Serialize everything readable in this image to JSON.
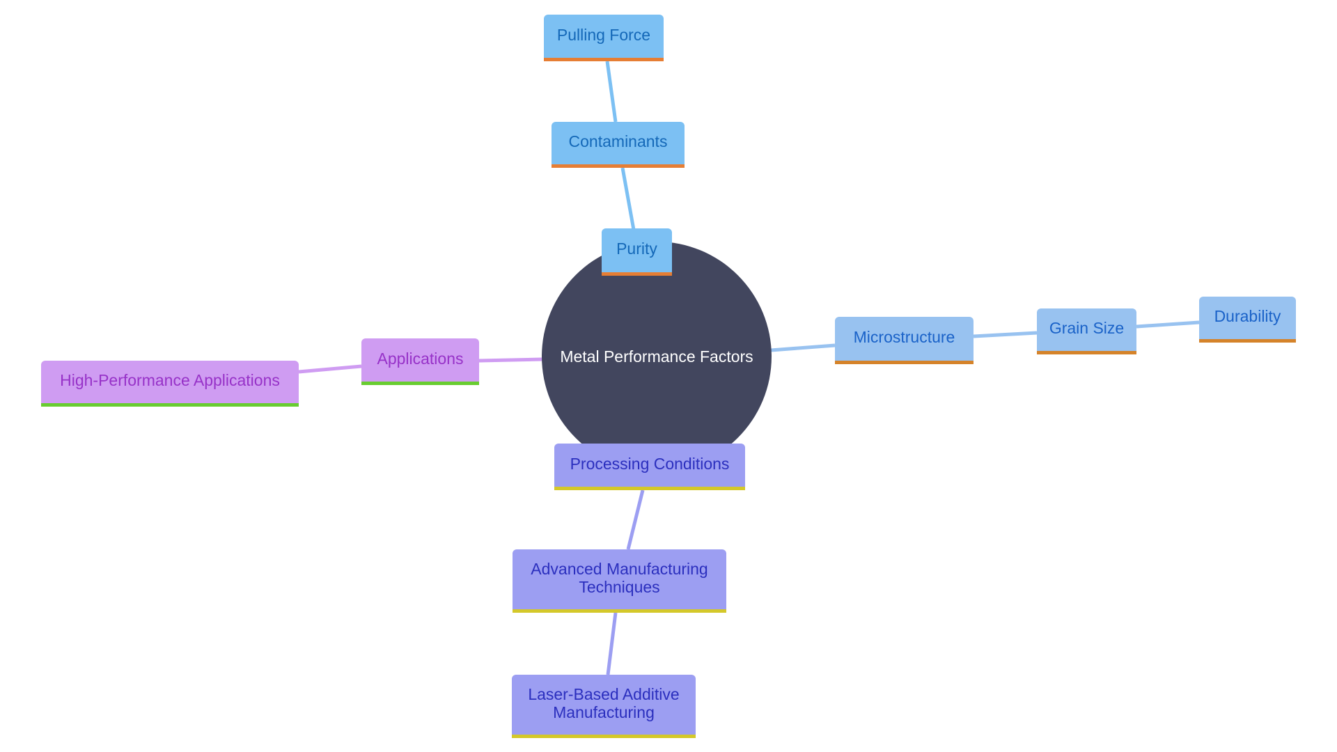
{
  "root": {
    "label": "Metal Performance Factors",
    "color": "#42465e"
  },
  "branches": [
    {
      "id": "purity",
      "colors": {
        "fill": "#7cc0f3",
        "text": "#1468b8",
        "underline": "#e67e34",
        "edge": "#7cc0f3"
      },
      "nodes": [
        {
          "label": "Purity"
        },
        {
          "label": "Contaminants"
        },
        {
          "label": "Pulling Force"
        }
      ]
    },
    {
      "id": "microstructure",
      "colors": {
        "fill": "#98c2f0",
        "text": "#1a62c8",
        "underline": "#d5832a",
        "edge": "#98c2f0"
      },
      "nodes": [
        {
          "label": "Microstructure"
        },
        {
          "label": "Grain Size"
        },
        {
          "label": "Durability"
        }
      ]
    },
    {
      "id": "applications",
      "colors": {
        "fill": "#cf9cf2",
        "text": "#9732c8",
        "underline": "#68cc30",
        "edge": "#cf9cf2"
      },
      "nodes": [
        {
          "label": "Applications"
        },
        {
          "label": "High-Performance Applications"
        }
      ]
    },
    {
      "id": "processing",
      "colors": {
        "fill": "#9c9ef2",
        "text": "#2b2fbe",
        "underline": "#d4c82a",
        "edge": "#9c9ef2"
      },
      "nodes": [
        {
          "label": "Processing Conditions"
        },
        {
          "label": "Advanced Manufacturing Techniques"
        },
        {
          "label": "Laser-Based Additive Manufacturing"
        }
      ]
    }
  ]
}
